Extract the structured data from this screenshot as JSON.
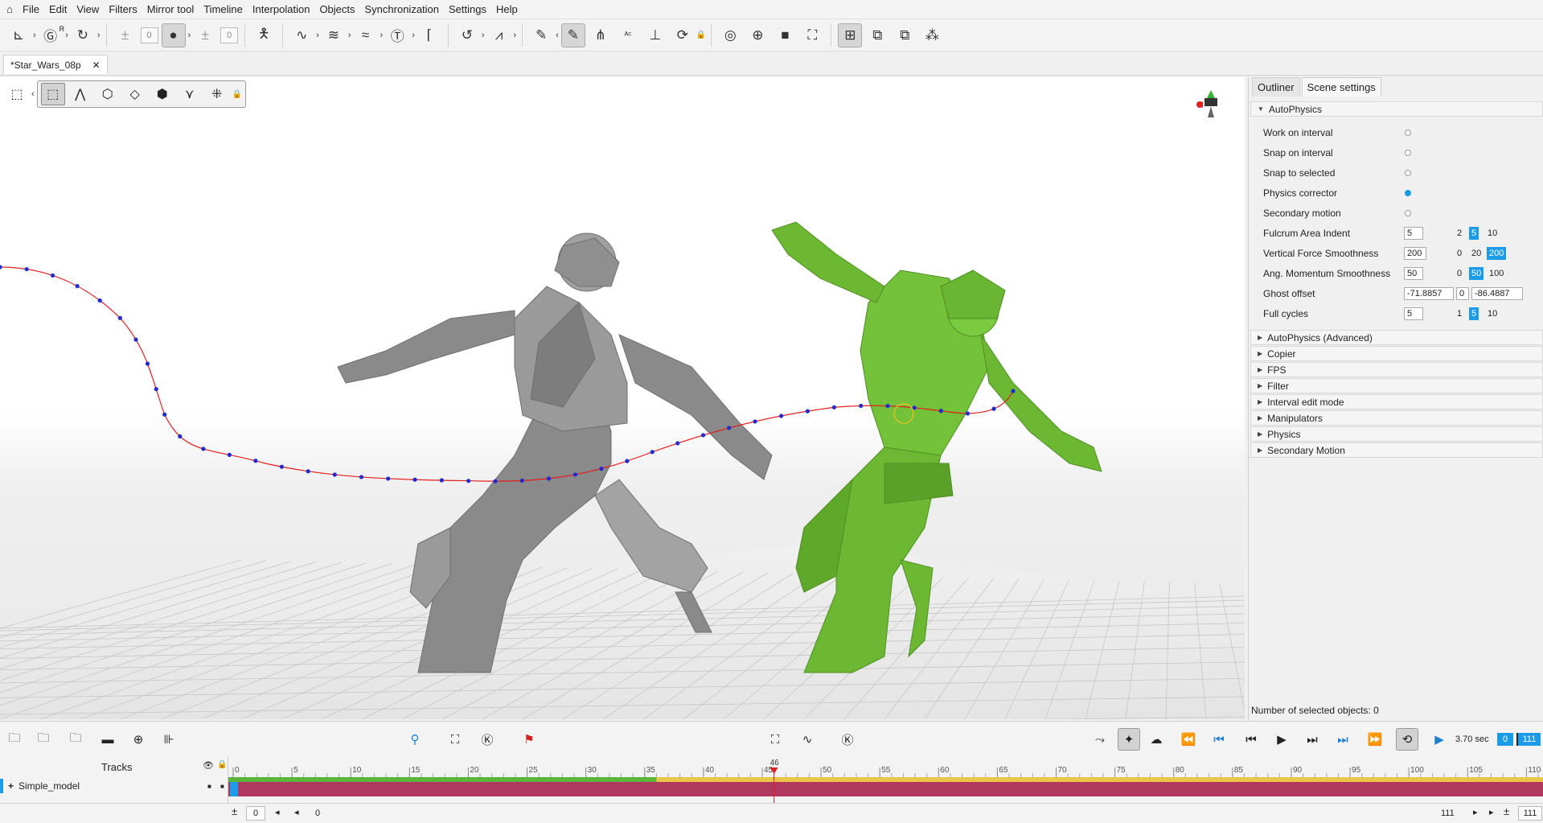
{
  "menu": [
    "File",
    "Edit",
    "View",
    "Filters",
    "Mirror tool",
    "Timeline",
    "Interpolation",
    "Objects",
    "Synchronization",
    "Settings",
    "Help"
  ],
  "toolbar": {
    "counter_a": "0",
    "counter_b": "0",
    "badge_r": "R"
  },
  "document_tab": {
    "title": "*Star_Wars_08p",
    "close": "✕"
  },
  "outliner": {
    "tabs": [
      "Outliner",
      "Scene settings"
    ],
    "section_open": "AutoPhysics",
    "props": {
      "work_on_interval": "Work on interval",
      "snap_on_interval": "Snap on interval",
      "snap_to_selected": "Snap to selected",
      "physics_corrector": "Physics corrector",
      "secondary_motion": "Secondary motion",
      "fulcrum": {
        "label": "Fulcrum Area Indent",
        "value": "5",
        "opts": [
          "2",
          "5",
          "10"
        ]
      },
      "vforce": {
        "label": "Vertical Force Smoothness",
        "value": "200",
        "opts": [
          "0",
          "20",
          "200"
        ]
      },
      "angmom": {
        "label": "Ang. Momentum Smoothness",
        "value": "50",
        "opts": [
          "0",
          "50",
          "100"
        ]
      },
      "ghost": {
        "label": "Ghost offset",
        "x": "-71.8857",
        "y": "0",
        "z": "-86.4887"
      },
      "cycles": {
        "label": "Full cycles",
        "value": "5",
        "opts": [
          "1",
          "5",
          "10"
        ]
      }
    },
    "collapsed": [
      "AutoPhysics (Advanced)",
      "Copier",
      "FPS",
      "Filter",
      "Interval edit mode",
      "Manipulators",
      "Physics",
      "Secondary Motion"
    ],
    "selected_count": "Number of selected objects: 0"
  },
  "playback": {
    "time": "3.70 sec",
    "start": "0",
    "end": "111"
  },
  "tracks": {
    "header": "Tracks",
    "model": "Simple_model",
    "current_frame": "46",
    "ticks": [
      "0",
      "5",
      "10",
      "15",
      "20",
      "25",
      "30",
      "35",
      "40",
      "45",
      "50",
      "55",
      "60",
      "65",
      "70",
      "75",
      "80",
      "85",
      "90",
      "95",
      "100",
      "105",
      "110"
    ]
  },
  "range": {
    "start": "0",
    "start_label": "0",
    "end": "111",
    "end_box": "111"
  },
  "colors": {
    "accent": "#1c9ce8",
    "ghost_model": "#8a8a8a",
    "active_model": "#6cb832",
    "track_bar": "#b0375e"
  }
}
